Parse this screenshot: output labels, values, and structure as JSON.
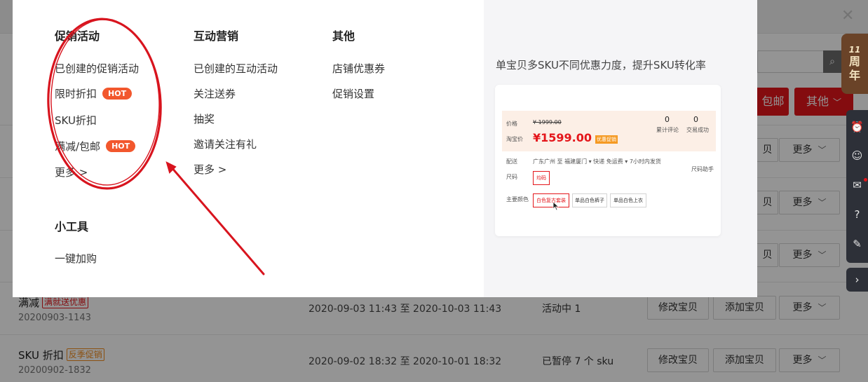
{
  "background": {
    "baoyou_btn": "包邮",
    "other_btn": "其他",
    "partial_label": "贝",
    "rows": [
      {
        "title": "满减",
        "badge": "满就送优惠",
        "sub": "20200903-1143",
        "time": "2020-09-03 11:43 至 2020-10-03 11:43",
        "status": "活动中 1",
        "edit": "修改宝贝",
        "add": "添加宝贝",
        "more": "更多"
      },
      {
        "title": "SKU 折扣",
        "badge": "反季促销",
        "sub": "20200902-1832",
        "time": "2020-09-02 18:32 至 2020-10-01 18:32",
        "status": "已暂停 7 个 sku",
        "edit": "修改宝贝",
        "add": "添加宝贝",
        "more": "更多"
      }
    ],
    "more_label": "更多"
  },
  "sidebar": {
    "anniversary_number": "11",
    "anniversary_text_1": "周",
    "anniversary_text_2": "年"
  },
  "menu": {
    "col1": {
      "heading": "促销活动",
      "items": [
        "已创建的促销活动",
        "限时折扣",
        "SKU折扣",
        "满减/包邮",
        "更多 >"
      ],
      "hot_label": "HOT"
    },
    "col2": {
      "heading": "互动营销",
      "items": [
        "已创建的互动活动",
        "关注送券",
        "抽奖",
        "邀请关注有礼",
        "更多 >"
      ]
    },
    "col3": {
      "heading": "其他",
      "items": [
        "店铺优惠券",
        "促销设置"
      ]
    },
    "tools": {
      "heading": "小工具",
      "items": [
        "一键加购"
      ]
    }
  },
  "promo": {
    "text": "单宝贝多SKU不同优惠力度，提升SKU转化率",
    "preview": {
      "price_label": "价格",
      "orig_price": "¥ 1999.00",
      "tb_label": "淘宝价",
      "price": "¥1599.00",
      "tag": "优惠促销",
      "reviews_num": "0",
      "reviews_label": "累计评论",
      "sales_num": "0",
      "sales_label": "交易成功",
      "ship_label": "配送",
      "ship_text": "广东广州 至  福建厦门 ▾  快递 免运费 ▾  7小时内发货",
      "size_label": "尺码",
      "size_helper": "尺码助手",
      "size_opt": "均码",
      "color_label": "主要颜色",
      "color_opts": [
        "白色复古套装",
        "单品白色裤子",
        "单品白色上衣"
      ]
    }
  },
  "colors": {
    "accent_red": "#e4161b",
    "hot_orange": "#f2572d",
    "annotation_red": "#d8141e"
  }
}
